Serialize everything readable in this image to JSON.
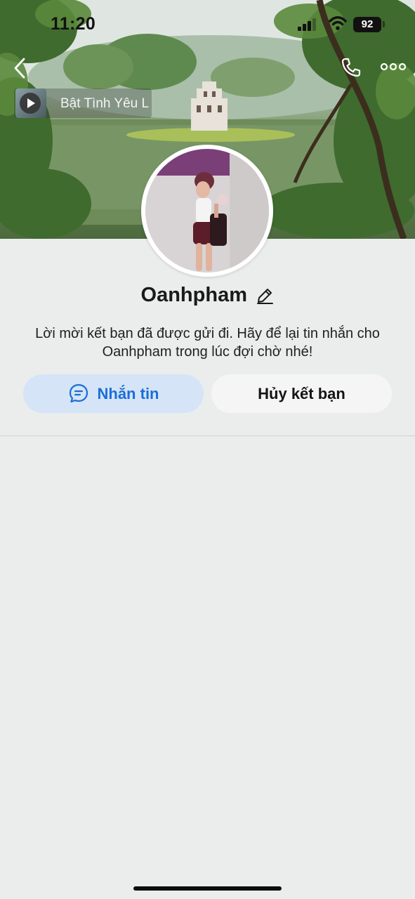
{
  "status_bar": {
    "time": "11:20",
    "battery": "92"
  },
  "cover": {
    "music_title": "Bật Tình Yêu L"
  },
  "profile": {
    "name": "Oanhpham",
    "message": "Lời mời kết bạn đã được gửi đi. Hãy để lại tin nhắn cho Oanhpham trong lúc đợi chờ nhé!"
  },
  "actions": {
    "message_label": "Nhắn tin",
    "unfriend_label": "Hủy kết bạn"
  },
  "icons": {
    "back": "chevron-left-icon",
    "call": "phone-icon",
    "more": "more-horizontal-icon",
    "edit": "pencil-icon",
    "chat": "chat-bubble-icon",
    "play": "play-icon"
  },
  "colors": {
    "accent": "#1a6ed8",
    "message_button_bg": "#d5e4f7",
    "unfriend_button_bg": "#f5f5f5",
    "page_bg": "#ebeded"
  }
}
